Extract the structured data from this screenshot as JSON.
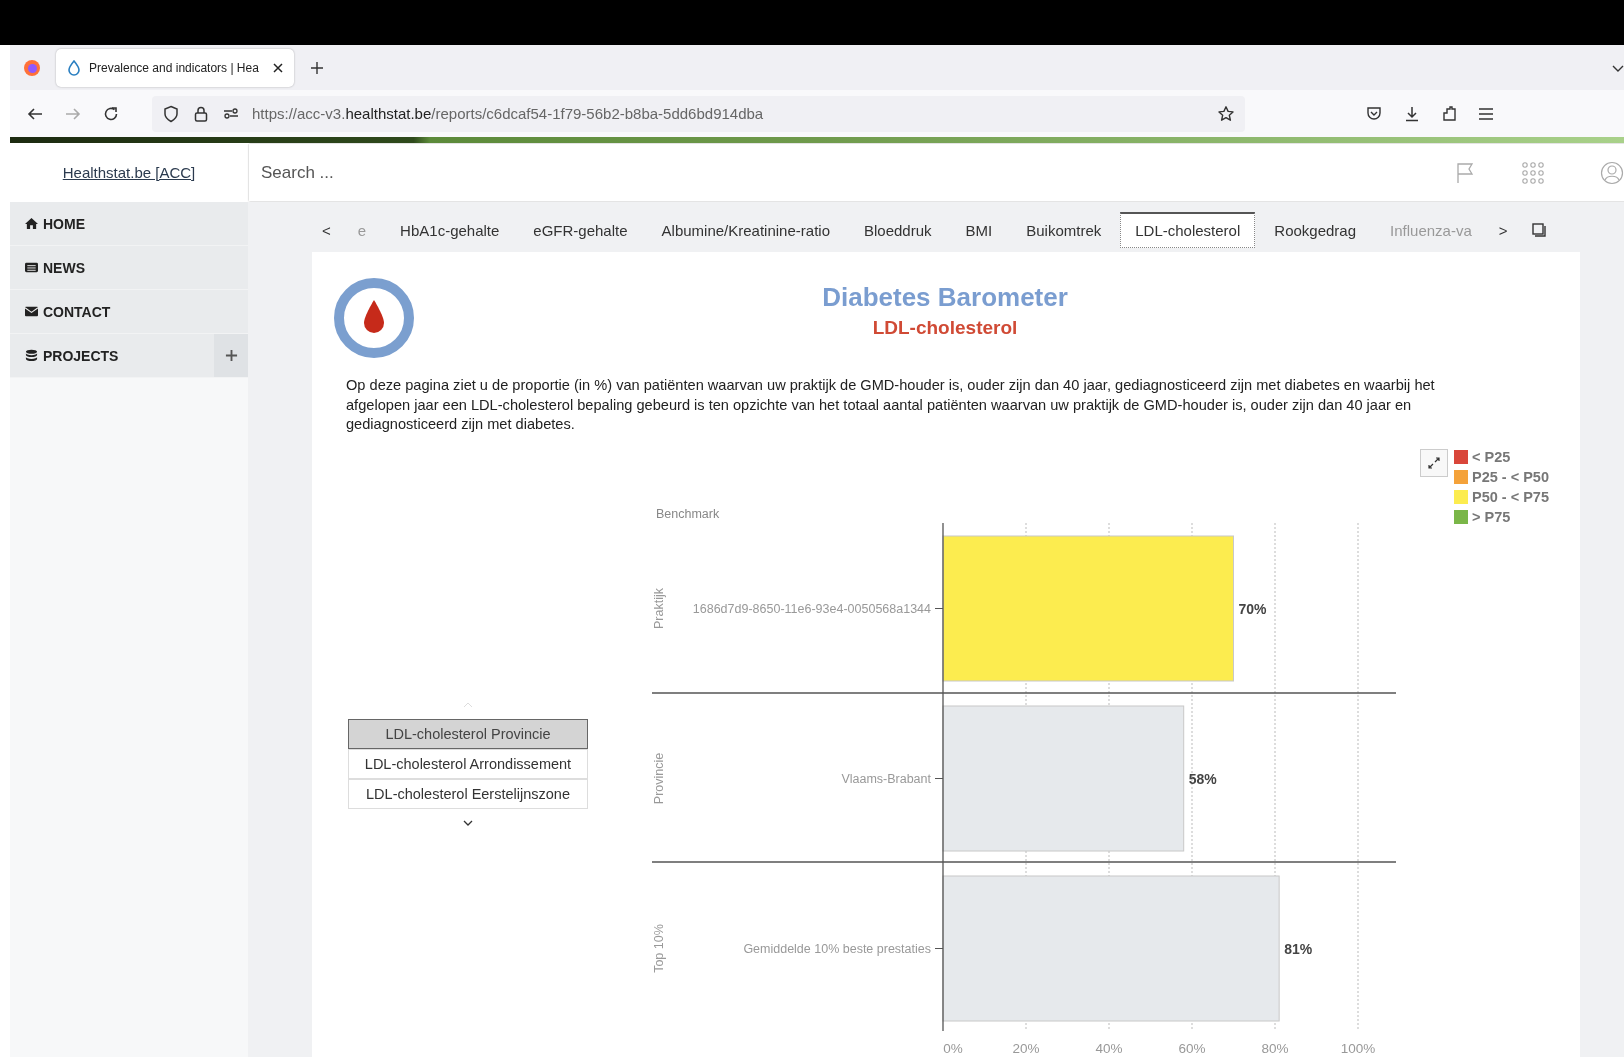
{
  "browser": {
    "tab_title": "Prevalence and indicators | Hea",
    "url_prefix": "https://acc-v3.",
    "url_domain": "healthstat.be",
    "url_path": "/reports/c6dcaf54-1f79-56b2-b8ba-5dd6bd914dba"
  },
  "site": {
    "logo": "Healthstat.be [ACC]",
    "search_placeholder": "Search ..."
  },
  "sidebar": {
    "items": [
      {
        "label": "HOME",
        "kind": "home",
        "expandable": false
      },
      {
        "label": "NEWS",
        "kind": "news",
        "expandable": false
      },
      {
        "label": "CONTACT",
        "kind": "contact",
        "expandable": false
      },
      {
        "label": "PROJECTS",
        "kind": "projects",
        "expandable": true
      }
    ]
  },
  "report_tabs": {
    "prev": "<",
    "next": ">",
    "tabs": [
      {
        "label": "e",
        "selected": false,
        "faded": true
      },
      {
        "label": "HbA1c-gehalte",
        "selected": false,
        "faded": false
      },
      {
        "label": "eGFR-gehalte",
        "selected": false,
        "faded": false
      },
      {
        "label": "Albumine/Kreatinine-ratio",
        "selected": false,
        "faded": false
      },
      {
        "label": "Bloeddruk",
        "selected": false,
        "faded": false
      },
      {
        "label": "BMI",
        "selected": false,
        "faded": false
      },
      {
        "label": "Buikomtrek",
        "selected": false,
        "faded": false
      },
      {
        "label": "LDL-cholesterol",
        "selected": true,
        "faded": false
      },
      {
        "label": "Rookgedrag",
        "selected": false,
        "faded": false
      },
      {
        "label": "Influenza-va",
        "selected": false,
        "faded": true
      }
    ]
  },
  "report": {
    "title": "Diabetes Barometer",
    "subtitle": "LDL-cholesterol",
    "description": "Op deze pagina ziet u de proportie (in %) van patiënten waarvan uw praktijk de GMD-houder is, ouder zijn dan 40 jaar, gediagnosticeerd zijn met diabetes en waarbij het afgelopen jaar een LDL-cholesterol bepaling gebeurd is ten opzichte van het totaal aantal patiënten waarvan uw praktijk de GMD-houder is, ouder zijn dan 40 jaar en gediagnosticeerd zijn met diabetes.",
    "selector": [
      {
        "label": "LDL-cholesterol Provincie",
        "selected": true
      },
      {
        "label": "LDL-cholesterol Arrondissement",
        "selected": false
      },
      {
        "label": "LDL-cholesterol Eerstelijnszone",
        "selected": false
      }
    ],
    "legend": [
      {
        "label": "< P25",
        "color": "#d9463a"
      },
      {
        "label": "P25 - < P50",
        "color": "#f4a23a"
      },
      {
        "label": "P50 - < P75",
        "color": "#fcec4f"
      },
      {
        "label": "> P75",
        "color": "#7ab648"
      }
    ],
    "bars": [
      {
        "group": "Praktijk",
        "color": "#fcec4f"
      },
      {
        "group": "Provincie",
        "color": "#e6e9ec"
      },
      {
        "group": "Top 10%",
        "color": "#e6e9ec"
      }
    ],
    "chart_data": {
      "type": "bar",
      "orientation": "horizontal",
      "grid": true,
      "categories": [
        "1686d7d9-8650-11e6-93e4-0050568a1344",
        "Vlaams-Brabant",
        "Gemiddelde 10% beste prestaties"
      ],
      "series": [
        {
          "name": "Benchmark",
          "values": [
            70,
            58,
            81
          ]
        }
      ],
      "value_labels": [
        "70%",
        "58%",
        "81%"
      ],
      "xlim": [
        0,
        100
      ],
      "xticks": [
        {
          "value": 0,
          "label": "0%"
        },
        {
          "value": 20,
          "label": "20%"
        },
        {
          "value": 40,
          "label": "40%"
        },
        {
          "value": 60,
          "label": "60%"
        },
        {
          "value": 80,
          "label": "80%"
        },
        {
          "value": 100,
          "label": "100%"
        }
      ]
    }
  }
}
